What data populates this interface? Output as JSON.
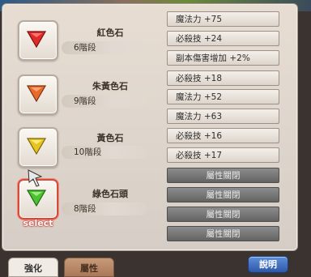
{
  "stones": [
    {
      "name": "紅色石",
      "level": "6階段",
      "gem_color": "#e02a2a",
      "selected": false
    },
    {
      "name": "朱黃色石",
      "level": "9階段",
      "gem_color": "#e8692a",
      "selected": false
    },
    {
      "name": "黃色石",
      "level": "10階段",
      "gem_color": "#e6c51e",
      "selected": false
    },
    {
      "name": "綠色石頭",
      "level": "8階段",
      "gem_color": "#4cc230",
      "selected": true
    }
  ],
  "select_label": "select",
  "stats": [
    {
      "text": "魔法力 +75",
      "locked": false
    },
    {
      "text": "必殺技 +24",
      "locked": false
    },
    {
      "text": "副本傷害增加 +2%",
      "locked": false
    },
    {
      "text": "必殺技 +18",
      "locked": false
    },
    {
      "text": "魔法力 +52",
      "locked": false
    },
    {
      "text": "魔法力 +63",
      "locked": false
    },
    {
      "text": "必殺技 +16",
      "locked": false
    },
    {
      "text": "必殺技 +17",
      "locked": false
    },
    {
      "text": "屬性關閉",
      "locked": true
    },
    {
      "text": "屬性關閉",
      "locked": true
    },
    {
      "text": "屬性關閉",
      "locked": true
    },
    {
      "text": "屬性關閉",
      "locked": true
    }
  ],
  "tabs": [
    {
      "label": "強化",
      "active": true
    },
    {
      "label": "屬性",
      "active": false
    }
  ],
  "help_button": "說明"
}
